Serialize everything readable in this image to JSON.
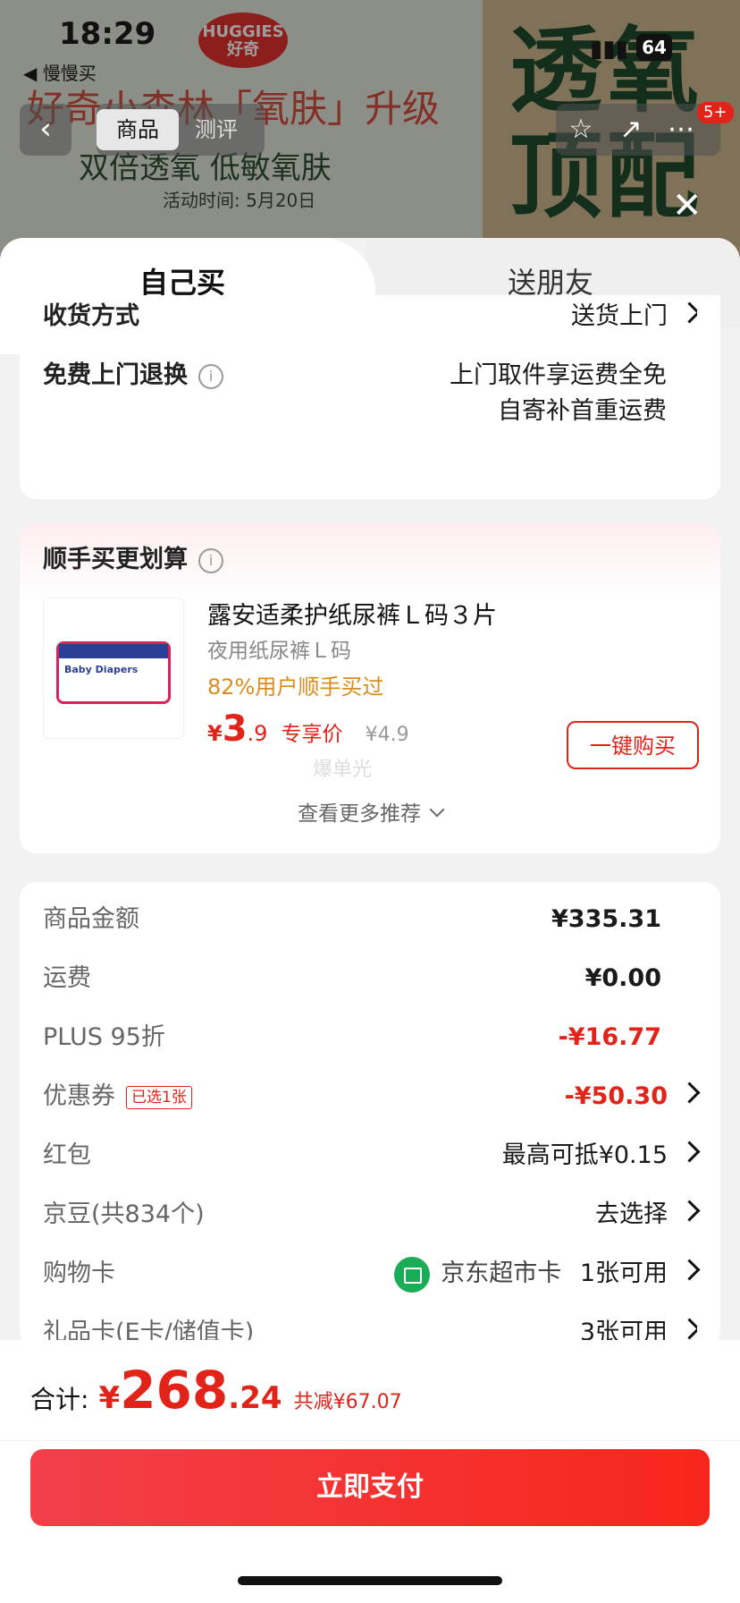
{
  "status_bar": {
    "time": "18:29",
    "network": "5G",
    "battery": "64"
  },
  "back_app": "◀ 慢慢买",
  "banner": {
    "brand_logo": "HUGGIES 好奇",
    "headline": "好奇小森林「氧肤」升级",
    "subline": "双倍透氧 低敏氧肤",
    "activity_time": "活动时间: 5月20日",
    "big_text": "透氧顶配"
  },
  "nav": {
    "tab_product": "商品",
    "tab_review": "测评",
    "more_badge": "5+"
  },
  "sheet_tabs": {
    "self_buy": "自己买",
    "gift_friend": "送朋友"
  },
  "delivery": {
    "method_label": "收货方式",
    "method_value": "送货上门",
    "return_label": "免费上门退换",
    "return_line1": "上门取件享运费全免",
    "return_line2": "自寄补首重运费"
  },
  "addon": {
    "title": "顺手买更划算",
    "product_name": "露安适柔护纸尿裤Ｌ码３片",
    "product_desc": "夜用纸尿裤Ｌ码",
    "product_stat": "82%用户顺手买过",
    "price_symbol": "¥",
    "price_int": "3",
    "price_dec": ".9",
    "price_tag": "专享价",
    "price_orig": "¥4.9",
    "watermark": "爆单光",
    "buy_label": "一键购买",
    "more_label": "查看更多推荐",
    "image_text": "Baby Diapers"
  },
  "summary": {
    "goods_label": "商品金额",
    "goods_value": "¥335.31",
    "freight_label": "运费",
    "freight_value": "¥0.00",
    "plus_label": "PLUS 95折",
    "plus_value": "-¥16.77",
    "coupon_label": "优惠券",
    "coupon_tag": "已选1张",
    "coupon_value": "-¥50.30",
    "redpack_label": "红包",
    "redpack_value": "最高可抵¥0.15",
    "jd_beans_label": "京豆(共834个)",
    "jd_beans_value": "去选择",
    "shopping_card_label": "购物卡",
    "shopping_card_name": "京东超市卡",
    "shopping_card_value": "1张可用",
    "gift_card_label": "礼品卡(E卡/储值卡)",
    "gift_card_value": "3张可用"
  },
  "bottom": {
    "total_label": "合计:",
    "total_symbol": "¥",
    "total_int": "268",
    "total_dec": ".24",
    "saved": "共减¥67.07",
    "pay_label": "立即支付"
  },
  "colors": {
    "accent": "#e2231a",
    "orange": "#d98d1c",
    "green": "#1aac57"
  }
}
